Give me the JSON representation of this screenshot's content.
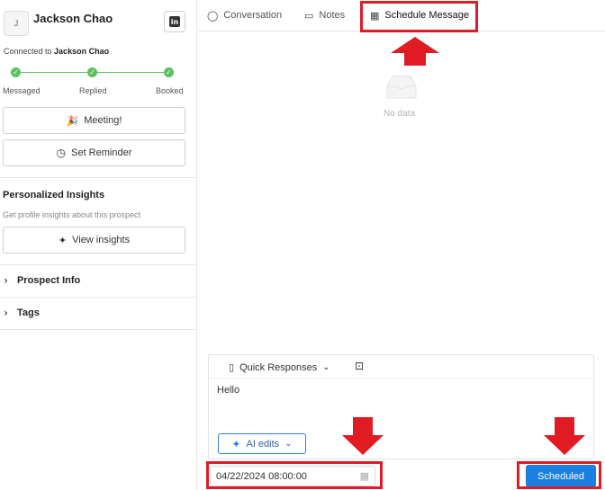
{
  "prospect": {
    "avatar_initial": "J",
    "name": "Jackson Chao",
    "connected_prefix": "Connected to ",
    "connected_name": "Jackson Chao"
  },
  "progress": {
    "steps": [
      "Messaged",
      "Replied",
      "Booked"
    ],
    "completed": 3
  },
  "actions": {
    "meeting_label": "Meeting!",
    "reminder_label": "Set Reminder"
  },
  "insights": {
    "title": "Personalized Insights",
    "hint": "Get profile insights about this prospect",
    "button_label": "View insights"
  },
  "sections": {
    "prospect_info": "Prospect Info",
    "tags": "Tags"
  },
  "tabs": {
    "conversation": "Conversation",
    "notes": "Notes",
    "schedule": "Schedule Message"
  },
  "empty_state": {
    "text": "No data"
  },
  "composer": {
    "quick_responses_label": "Quick Responses",
    "message": "Hello",
    "ai_edits_label": "AI edits"
  },
  "schedule": {
    "datetime_value": "04/22/2024 08:00:00",
    "scheduled_button": "Scheduled"
  },
  "colors": {
    "accent": "#1a7fe0",
    "success": "#5cc15c",
    "highlight": "#e01b24"
  }
}
